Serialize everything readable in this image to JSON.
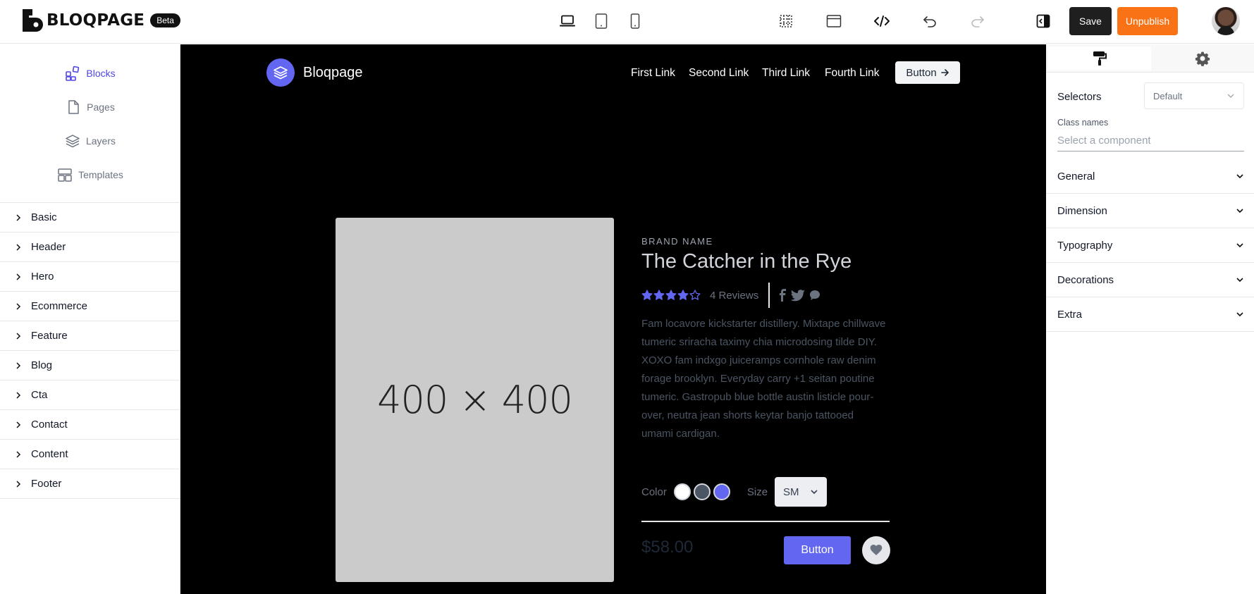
{
  "app": {
    "name": "BLOQPAGE",
    "badge": "Beta"
  },
  "toolbar": {
    "save_label": "Save",
    "unpublish_label": "Unpublish"
  },
  "left_nav": [
    {
      "label": "Blocks",
      "icon": "blocks-icon",
      "active": true
    },
    {
      "label": "Pages",
      "icon": "page-icon",
      "active": false
    },
    {
      "label": "Layers",
      "icon": "layers-icon",
      "active": false
    },
    {
      "label": "Templates",
      "icon": "templates-icon",
      "active": false
    }
  ],
  "categories": [
    "Basic",
    "Header",
    "Hero",
    "Ecommerce",
    "Feature",
    "Blog",
    "Cta",
    "Contact",
    "Content",
    "Footer"
  ],
  "site": {
    "logo_text": "Bloqpage",
    "links": [
      "First Link",
      "Second Link",
      "Third Link",
      "Fourth Link"
    ],
    "button_label": "Button"
  },
  "product": {
    "image_placeholder": "400 × 400",
    "brand": "BRAND NAME",
    "title": "The Catcher in the Rye",
    "rating": 4,
    "rating_max": 5,
    "reviews": "4 Reviews",
    "description": "Fam locavore kickstarter distillery. Mixtape chillwave tumeric sriracha taximy chia microdosing tilde DIY. XOXO fam indxgo juiceramps cornhole raw denim forage brooklyn. Everyday carry +1 seitan poutine tumeric. Gastropub blue bottle austin listicle pour-over, neutra jean shorts keytar banjo tattooed umami cardigan.",
    "color_label": "Color",
    "colors": [
      "#ffffff",
      "#4b5563",
      "#6366f1"
    ],
    "size_label": "Size",
    "size_value": "SM",
    "price": "$58.00",
    "buy_label": "Button"
  },
  "panel": {
    "selectors_label": "Selectors",
    "selectors_value": "Default",
    "class_names_label": "Class names",
    "class_names_placeholder": "Select a component",
    "sections": [
      "General",
      "Dimension",
      "Typography",
      "Decorations",
      "Extra"
    ]
  },
  "colors": {
    "accent": "#6366f1",
    "unpublish": "#f97316",
    "save": "#1f1f1f"
  }
}
